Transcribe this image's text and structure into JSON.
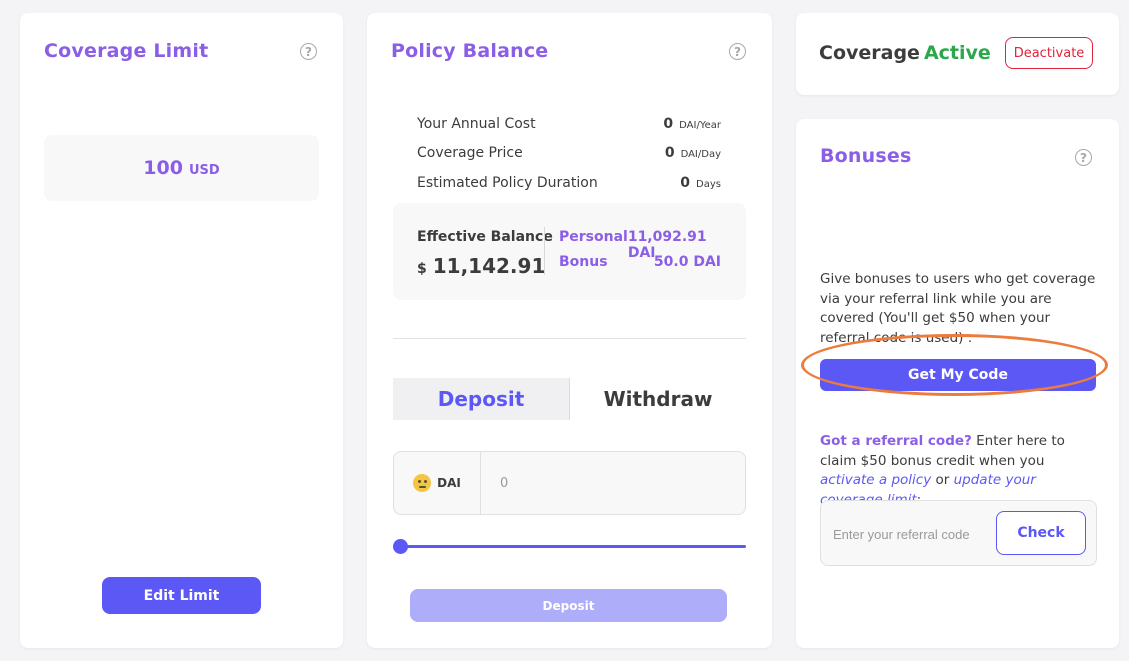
{
  "coverage_limit": {
    "title": "Coverage Limit",
    "help": "?",
    "value": "100",
    "unit": "USD",
    "edit_label": "Edit Limit"
  },
  "policy_balance": {
    "title": "Policy Balance",
    "help": "?",
    "rows": [
      {
        "label": "Your Annual Cost",
        "value": "0",
        "unit": "DAI/Year"
      },
      {
        "label": "Coverage Price",
        "value": "0",
        "unit": "DAI/Day"
      },
      {
        "label": "Estimated Policy Duration",
        "value": "0",
        "unit": "Days"
      }
    ],
    "effective_label": "Effective Balance",
    "effective_currency": "$",
    "effective_amount": "11,142.91",
    "personal_label": "Personal",
    "personal_value": "11,092.91 DAI",
    "bonus_label": "Bonus",
    "bonus_value": "50.0 DAI",
    "tabs": [
      "Deposit",
      "Withdraw"
    ],
    "active_tab": "Deposit",
    "input_unit": "DAI",
    "input_value": "0",
    "slider_value": 0,
    "deposit_button": "Deposit"
  },
  "coverage_status": {
    "label": "Coverage",
    "status": "Active",
    "deactivate_label": "Deactivate"
  },
  "bonuses": {
    "title": "Bonuses",
    "help": "?",
    "description": "Give bonuses to users who get coverage via your referral link while you are covered (You'll get $50 when your referral code is used) :",
    "get_code_label": "Get My Code",
    "referral_question": "Got a referral code?",
    "referral_text_1": " Enter here to claim $50 bonus credit when you ",
    "referral_link_1": "activate a policy",
    "referral_text_2": " or ",
    "referral_link_2": "update your coverage limit",
    "referral_text_3": ":",
    "referral_placeholder": "Enter your referral code",
    "check_label": "Check"
  },
  "colors": {
    "accent_purple": "#8b5ee6",
    "primary_blue": "#5b58f5",
    "active_green": "#2aa84a",
    "danger_red": "#e0243b",
    "highlight_orange": "#ec7c3e"
  }
}
